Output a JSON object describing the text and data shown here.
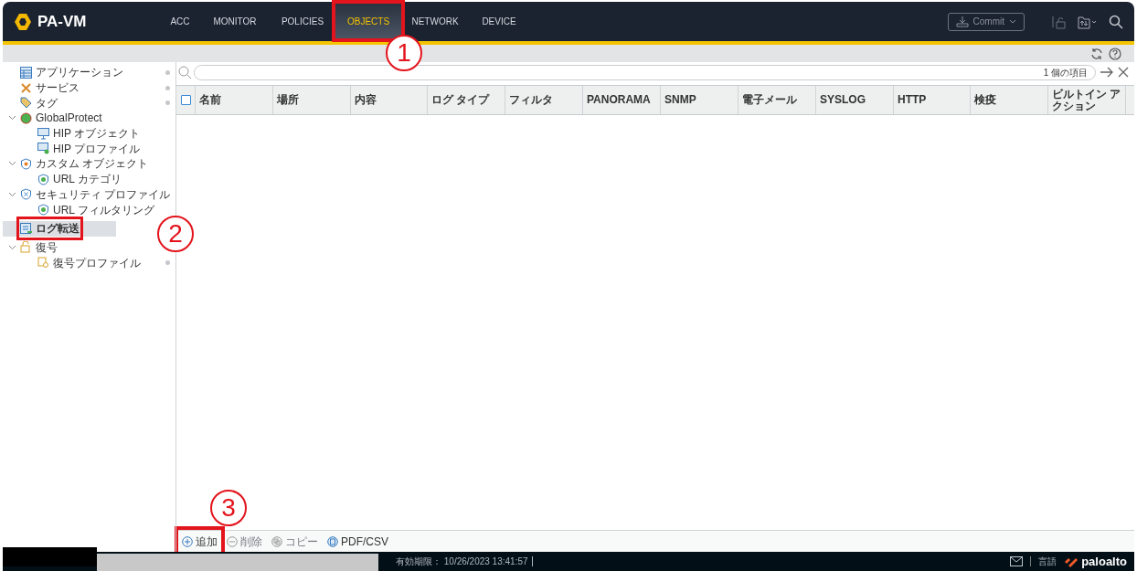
{
  "header": {
    "logo": "PA-VM",
    "tabs": [
      {
        "label": "ACC",
        "selected": false
      },
      {
        "label": "MONITOR",
        "selected": false
      },
      {
        "label": "POLICIES",
        "selected": false
      },
      {
        "label": "OBJECTS",
        "selected": true
      },
      {
        "label": "NETWORK",
        "selected": false
      },
      {
        "label": "DEVICE",
        "selected": false
      }
    ],
    "commit": "Commit"
  },
  "sidebar": {
    "items": [
      {
        "label": "アプリケーション",
        "selected": false,
        "dot": true
      },
      {
        "label": "サービス",
        "selected": false,
        "dot": true
      },
      {
        "label": "タグ",
        "selected": false,
        "dot": true
      },
      {
        "label": "GlobalProtect",
        "selected": false,
        "expanded": true,
        "children": [
          {
            "label": "HIP オブジェクト",
            "selected": false
          },
          {
            "label": "HIP プロファイル",
            "selected": false
          }
        ]
      },
      {
        "label": "カスタム オブジェクト",
        "selected": false,
        "expanded": true,
        "children": [
          {
            "label": "URL カテゴリ",
            "selected": false
          }
        ]
      },
      {
        "label": "セキュリティ プロファイル",
        "selected": false,
        "expanded": true,
        "children": [
          {
            "label": "URL フィルタリング",
            "selected": false
          }
        ]
      },
      {
        "label": "ログ転送",
        "selected": true
      },
      {
        "label": "復号",
        "selected": false,
        "expanded": true,
        "children": [
          {
            "label": "復号プロファイル",
            "selected": false,
            "dot": true
          }
        ]
      }
    ]
  },
  "search": {
    "count": "1 個の項目"
  },
  "table": {
    "columns": [
      "名前",
      "場所",
      "内容",
      "ログ タイプ",
      "フィルタ",
      "PANORAMA",
      "SNMP",
      "電子メール",
      "SYSLOG",
      "HTTP",
      "検疫",
      "ビルトイン アクション"
    ],
    "select_all_checked": false
  },
  "toolbar": [
    {
      "label": "追加",
      "disabled": false
    },
    {
      "label": "削除",
      "disabled": true
    },
    {
      "label": "コピー",
      "disabled": true
    },
    {
      "label": "PDF/CSV",
      "disabled": false
    }
  ],
  "status_bar": {
    "expiry": "有効期限： 10/26/2023 13:41:57",
    "language": "言語",
    "brand": "paloalto"
  },
  "annotations": [
    "1",
    "2",
    "3"
  ]
}
